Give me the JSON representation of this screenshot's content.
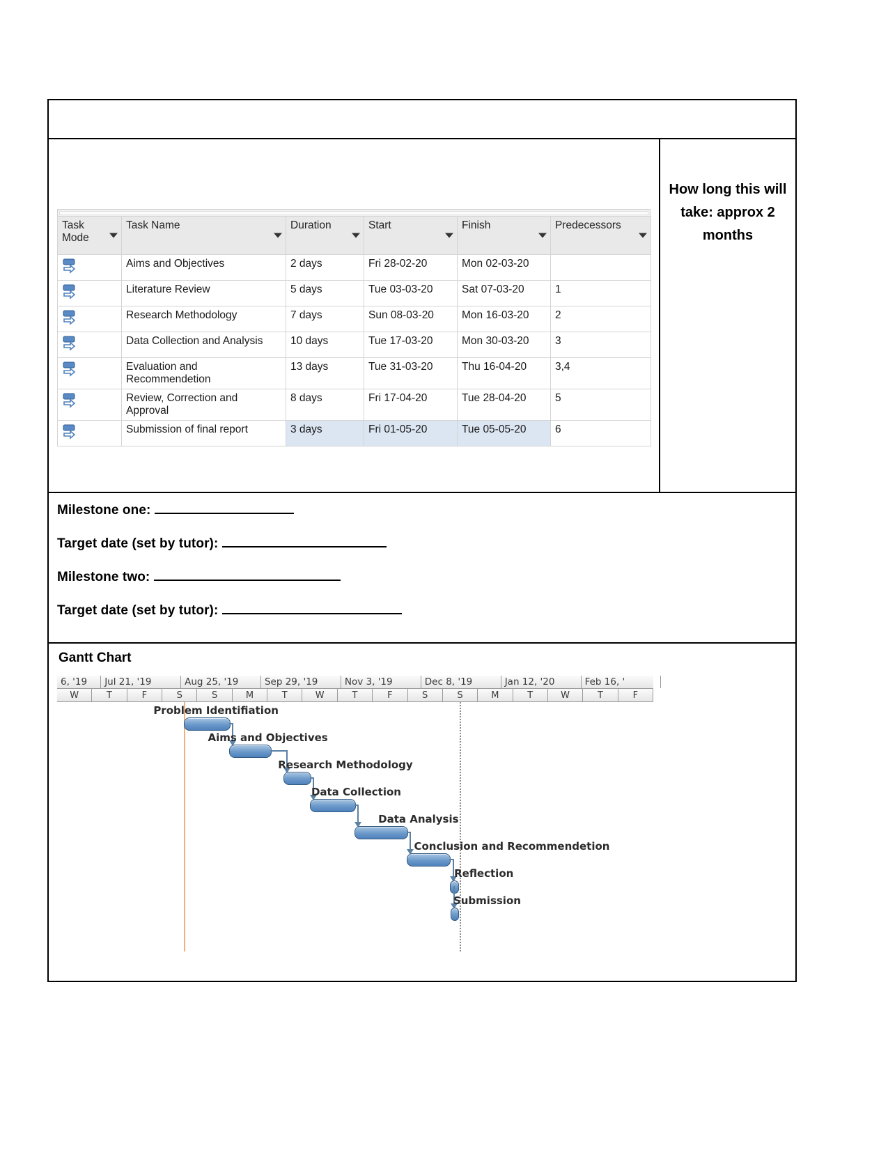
{
  "note": {
    "line1": "How long this will",
    "line2": "take: approx 2",
    "line3": "months"
  },
  "project_table": {
    "columns": [
      {
        "label": "Task Mode",
        "key": "mode",
        "caret": true,
        "highlight": false
      },
      {
        "label": "Task Name",
        "key": "name",
        "caret": true,
        "highlight": false
      },
      {
        "label": "Duration",
        "key": "duration",
        "caret": true,
        "highlight": false
      },
      {
        "label": "Start",
        "key": "start",
        "caret": true,
        "highlight": true
      },
      {
        "label": "Finish",
        "key": "finish",
        "caret": true,
        "highlight": false
      },
      {
        "label": "Predecessors",
        "key": "predecessors",
        "caret": true,
        "highlight": true
      }
    ],
    "header": {
      "task_mode": "Task Mode",
      "task_name": "Task Name",
      "duration": "Duration",
      "start": "Start",
      "finish": "Finish",
      "predecessors": "Predecessors"
    },
    "rows": [
      {
        "name": "Aims and Objectives",
        "duration": "2 days",
        "start": "Fri 28-02-20",
        "finish": "Mon 02-03-20",
        "predecessors": ""
      },
      {
        "name": "Literature Review",
        "duration": "5 days",
        "start": "Tue 03-03-20",
        "finish": "Sat 07-03-20",
        "predecessors": "1"
      },
      {
        "name": "Research Methodology",
        "duration": "7 days",
        "start": "Sun 08-03-20",
        "finish": "Mon 16-03-20",
        "predecessors": "2"
      },
      {
        "name": "Data Collection and Analysis",
        "duration": "10 days",
        "start": "Tue 17-03-20",
        "finish": "Mon 30-03-20",
        "predecessors": "3"
      },
      {
        "name": "Evaluation and Recommendetion",
        "duration": "13 days",
        "start": "Tue 31-03-20",
        "finish": "Thu 16-04-20",
        "predecessors": "3,4"
      },
      {
        "name": "Review, Correction and Approval",
        "duration": "8 days",
        "start": "Fri 17-04-20",
        "finish": "Tue 28-04-20",
        "predecessors": "5"
      },
      {
        "name": "Submission of final report",
        "duration": "3 days",
        "start": "Fri 01-05-20",
        "finish": "Tue 05-05-20",
        "predecessors": "6"
      }
    ]
  },
  "milestones": {
    "milestone_one_label": "Milestone one:",
    "target_one_label": "Target date (set by tutor):",
    "milestone_two_label": "Milestone two:",
    "target_two_label": "Target date (set by tutor):"
  },
  "gantt": {
    "title": "Gantt Chart",
    "chart_data": {
      "type": "bar",
      "title": "Gantt Chart",
      "xlabel": "",
      "ylabel": "",
      "axis_months": [
        "6, '19",
        "Jul 21, '19",
        "Aug 25, '19",
        "Sep 29, '19",
        "Nov 3, '19",
        "Dec 8, '19",
        "Jan 12, '20",
        "Feb 16, '"
      ],
      "axis_days": [
        "W",
        "T",
        "F",
        "S",
        "S",
        "M",
        "T",
        "W",
        "T",
        "F",
        "S",
        "S",
        "M",
        "T",
        "W",
        "T",
        "F"
      ],
      "tasks": [
        {
          "name": "Problem Identifiation",
          "bar_start_pct": 21.3,
          "bar_width_pct": 7.5
        },
        {
          "name": "Aims and Objectives",
          "bar_start_pct": 28.8,
          "bar_width_pct": 7.0
        },
        {
          "name": "Research Methodology",
          "bar_start_pct": 38.0,
          "bar_width_pct": 4.4
        },
        {
          "name": "Data Collection",
          "bar_start_pct": 42.4,
          "bar_width_pct": 7.5
        },
        {
          "name": "Data Analysis",
          "bar_start_pct": 49.9,
          "bar_width_pct": 8.8
        },
        {
          "name": "Conclusion and Recommendetion",
          "bar_start_pct": 58.7,
          "bar_width_pct": 7.1
        },
        {
          "name": "Reflection",
          "bar_start_pct": 65.9,
          "bar_width_pct": 1.3
        },
        {
          "name": "Submission",
          "bar_start_pct": 66.0,
          "bar_width_pct": 1.0
        }
      ],
      "markers": {
        "today_line_pct": 67.5,
        "project_start_line_pct": 21.3
      }
    }
  }
}
